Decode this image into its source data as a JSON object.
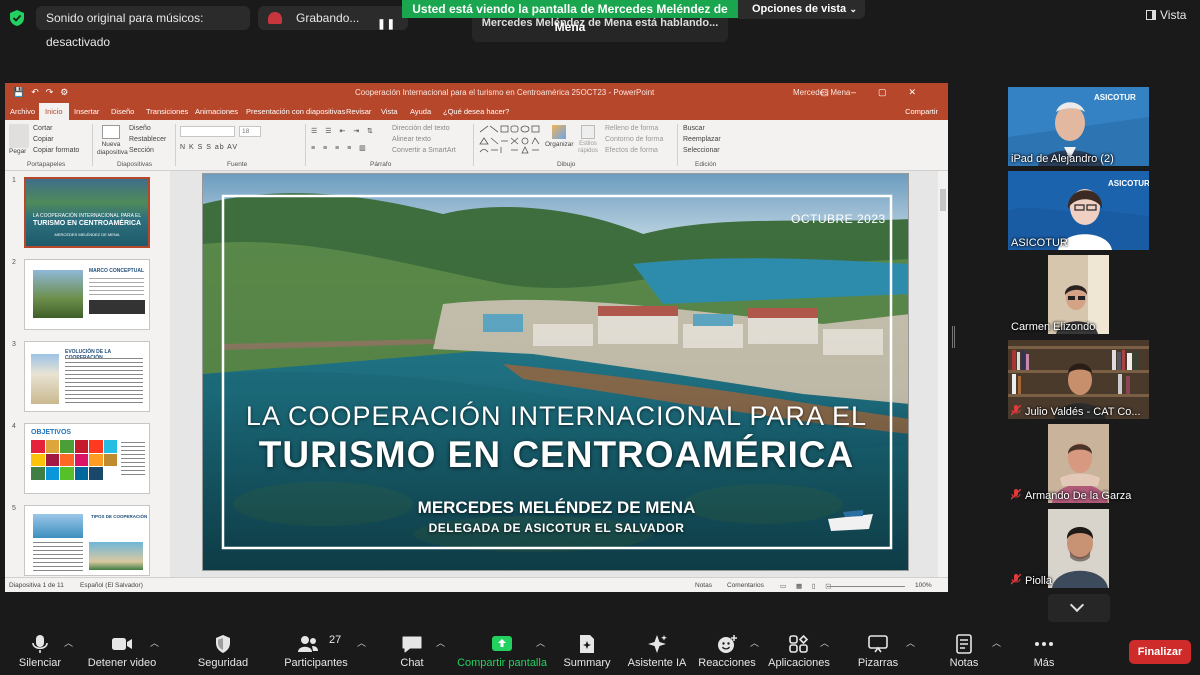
{
  "top": {
    "audio_status": "Sonido original para músicos: desactivado",
    "recording": "Grabando...",
    "share_banner": "Usted está viendo la pantalla de Mercedes Meléndez de Mena",
    "view_options": "Opciones de vista",
    "speaking": "Mercedes Meléndez de Mena está hablando...",
    "vista": "Vista"
  },
  "ppt": {
    "doc_title": "Cooperación Internacional para el turismo en Centroamérica 25OCT23  -  PowerPoint",
    "user": "Mercedes Mena",
    "tabs": [
      "Archivo",
      "Inicio",
      "Insertar",
      "Diseño",
      "Transiciones",
      "Animaciones",
      "Presentación con diapositivas",
      "Revisar",
      "Vista",
      "Ayuda",
      "¿Qué desea hacer?"
    ],
    "share": "Compartir",
    "ribbon": {
      "paste": "Pegar",
      "cut": "Cortar",
      "copy": "Copiar",
      "format_painter": "Copiar formato",
      "clipboard": "Portapapeles",
      "new_slide": "Nueva diapositiva",
      "layout": "Diseño",
      "reset": "Restablecer",
      "section": "Sección",
      "slides": "Diapositivas",
      "font_size": "18",
      "font_style": "N  K  S  S  ab  AV",
      "font": "Fuente",
      "text_direction": "Dirección del texto",
      "align_text": "Alinear texto",
      "smartart": "Convertir a SmartArt",
      "paragraph": "Párrafo",
      "arrange": "Organizar",
      "quick_styles": "Estilos rápidos",
      "shape_fill": "Relleno de forma",
      "shape_outline": "Contorno de forma",
      "shape_effects": "Efectos de forma",
      "drawing": "Dibujo",
      "find": "Buscar",
      "replace": "Reemplazar",
      "select": "Seleccionar",
      "editing": "Edición"
    },
    "thumb_numbers": [
      "1",
      "2",
      "3",
      "4",
      "5"
    ],
    "thumbs": {
      "t1_line1": "LA COOPERACIÓN INTERNACIONAL PARA EL",
      "t1_line2": "TURISMO EN CENTROAMÉRICA",
      "t1_line3": "MERCEDES MELÉNDEZ DE MENA",
      "t2_title": "MARCO CONCEPTUAL",
      "t3_title": "EVOLUCIÓN DE LA COOPERACIÓN",
      "t4_title": "OBJETIVOS",
      "t5_title": "TIPOS DE COOPERACIÓN"
    },
    "slide": {
      "date": "OCTUBRE 2023",
      "title_line1": "LA COOPERACIÓN INTERNACIONAL PARA EL",
      "title_line2": "TURISMO EN CENTROAMÉRICA",
      "author": "MERCEDES MELÉNDEZ DE MENA",
      "role": "DELEGADA DE ASICOTUR EL SALVADOR"
    },
    "status": {
      "slide_count": "Diapositiva 1 de 11",
      "language": "Español (El Salvador)",
      "notes": "Notas",
      "comments": "Comentarios",
      "zoom": "100%"
    }
  },
  "participants": [
    {
      "name": "iPad de Alejandro (2)",
      "muted": false
    },
    {
      "name": "ASICOTUR",
      "muted": false
    },
    {
      "name": "Carmen Elizondo",
      "muted": false
    },
    {
      "name": "Julio Valdés - CAT Co...",
      "muted": true
    },
    {
      "name": "Armando De la Garza",
      "muted": true
    },
    {
      "name": "Piolla",
      "muted": true
    }
  ],
  "logo_text": "ASICOTUR",
  "toolbar": {
    "mute": "Silenciar",
    "video": "Detener video",
    "security": "Seguridad",
    "participants": "Participantes",
    "participant_count": "27",
    "chat": "Chat",
    "share": "Compartir pantalla",
    "summary": "Summary",
    "ai": "Asistente IA",
    "reactions": "Reacciones",
    "apps": "Aplicaciones",
    "whiteboards": "Pizarras",
    "notes": "Notas",
    "more": "Más",
    "end": "Finalizar"
  },
  "colors": {
    "zoom_green": "#1aa54f",
    "ppt_accent": "#b7472a",
    "end_red": "#cf2b2b"
  }
}
